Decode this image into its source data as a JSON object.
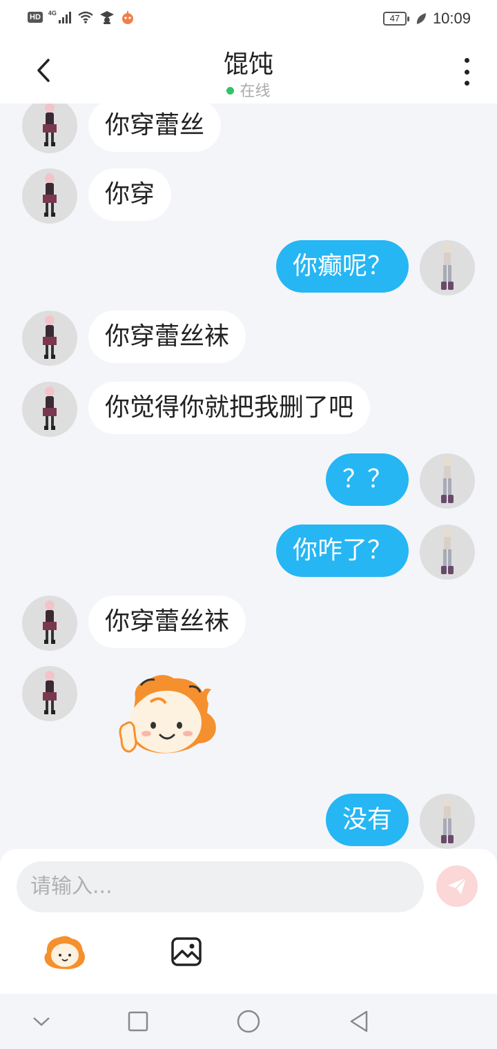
{
  "status_bar": {
    "hd": "HD",
    "network": "4G",
    "battery": "47",
    "time": "10:09"
  },
  "header": {
    "title": "馄饨",
    "status": "在线"
  },
  "messages": [
    {
      "from": "other",
      "text": "你穿蕾丝"
    },
    {
      "from": "other",
      "text": "你穿"
    },
    {
      "from": "me",
      "text": "你癫呢？"
    },
    {
      "from": "other",
      "text": "你穿蕾丝袜"
    },
    {
      "from": "other",
      "text": "你觉得你就把我删了吧"
    },
    {
      "from": "me",
      "text": "？？"
    },
    {
      "from": "me",
      "text": "你咋了？"
    },
    {
      "from": "other",
      "text": "你穿蕾丝袜"
    },
    {
      "from": "other",
      "sticker": "waving-girl-sticker"
    },
    {
      "from": "me",
      "text": "没有"
    }
  ],
  "input": {
    "placeholder": "请输入..."
  },
  "colors": {
    "outgoing_bubble": "#26b6f4",
    "incoming_bubble": "#ffffff",
    "online_dot": "#2fc46a",
    "send_button": "#fbd7d7"
  },
  "icons": {
    "back": "chevron-left-icon",
    "more": "more-vertical-icon",
    "send": "paper-plane-icon",
    "emoji": "sticker-face-icon",
    "image": "image-icon"
  }
}
